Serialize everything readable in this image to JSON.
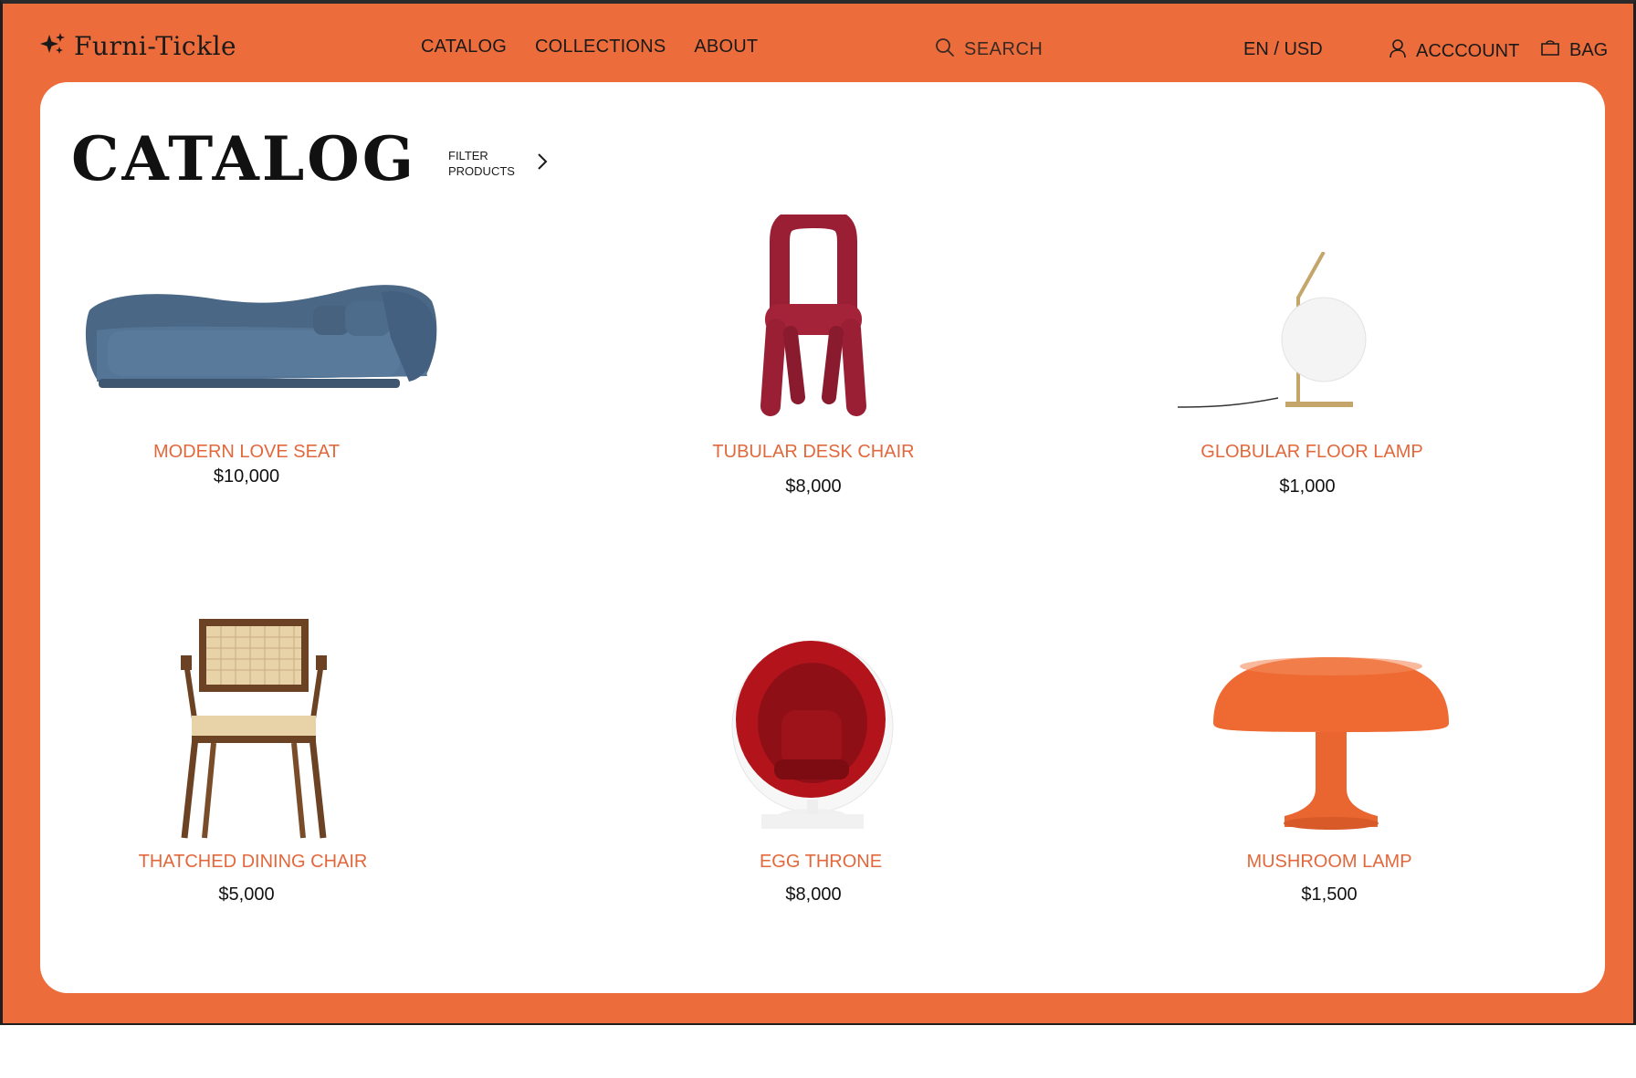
{
  "brand": {
    "name": "Furni-Tickle",
    "icon": "sparkle-icon"
  },
  "nav": {
    "catalog": "CATALOG",
    "collections": "COLLECTIONS",
    "about": "ABOUT"
  },
  "search": {
    "label": "SEARCH",
    "icon": "search-icon"
  },
  "locale": {
    "label": "EN / USD"
  },
  "account": {
    "label": "ACCCOUNT",
    "icon": "user-icon"
  },
  "bag": {
    "label": "BAG",
    "icon": "bag-icon"
  },
  "page": {
    "title": "CATALOG",
    "filter_line1": "FILTER",
    "filter_line2": "PRODUCTS"
  },
  "colors": {
    "brand_orange": "#ec6d3b",
    "name_orange": "#e2683c",
    "text": "#111111"
  },
  "products": [
    {
      "name": "MODERN LOVE SEAT",
      "price": "$10,000"
    },
    {
      "name": "TUBULAR DESK CHAIR",
      "price": "$8,000"
    },
    {
      "name": "GLOBULAR FLOOR LAMP",
      "price": "$1,000"
    },
    {
      "name": "THATCHED DINING CHAIR",
      "price": "$5,000"
    },
    {
      "name": "EGG THRONE",
      "price": "$8,000"
    },
    {
      "name": "MUSHROOM LAMP",
      "price": "$1,500"
    }
  ]
}
